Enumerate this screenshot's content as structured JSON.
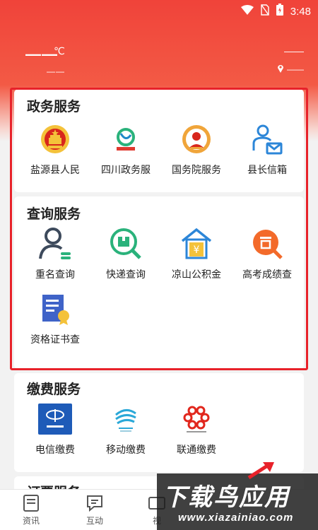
{
  "status": {
    "time": "3:48"
  },
  "weather": {
    "temp": "——",
    "unit": "℃",
    "desc": "——",
    "location": "——",
    "location_sub": "——"
  },
  "gov": {
    "title": "政务服务",
    "items": [
      {
        "label": "盐源县人民",
        "icon": "national-emblem-icon"
      },
      {
        "label": "四川政务服",
        "icon": "sichuan-gov-logo-icon"
      },
      {
        "label": "国务院服务",
        "icon": "state-council-emblem-icon"
      },
      {
        "label": "县长信箱",
        "icon": "mailbox-person-icon"
      }
    ]
  },
  "query": {
    "title": "查询服务",
    "items": [
      {
        "label": "重名查询",
        "icon": "person-search-icon"
      },
      {
        "label": "快递查询",
        "icon": "package-search-icon"
      },
      {
        "label": "凉山公积金",
        "icon": "house-yuan-icon"
      },
      {
        "label": "高考成绩查",
        "icon": "exam-search-icon"
      },
      {
        "label": "资格证书查",
        "icon": "certificate-icon"
      }
    ]
  },
  "pay": {
    "title": "缴费服务",
    "items": [
      {
        "label": "电信缴费",
        "icon": "china-telecom-icon"
      },
      {
        "label": "移动缴费",
        "icon": "china-mobile-icon"
      },
      {
        "label": "联通缴费",
        "icon": "china-unicom-icon"
      }
    ]
  },
  "next_section": {
    "title": "订票服务"
  },
  "tabs": [
    {
      "label": "资讯",
      "icon": "news-icon"
    },
    {
      "label": "互动",
      "icon": "chat-icon"
    },
    {
      "label": "视",
      "icon": "video-icon"
    }
  ],
  "watermark": {
    "main": "下载鸟应用",
    "sub": "www.xiazainiao.com"
  },
  "colors": {
    "brand_red": "#f0433a",
    "highlight": "#e8222a",
    "blue": "#1e5bb8",
    "green": "#2ab27b"
  }
}
